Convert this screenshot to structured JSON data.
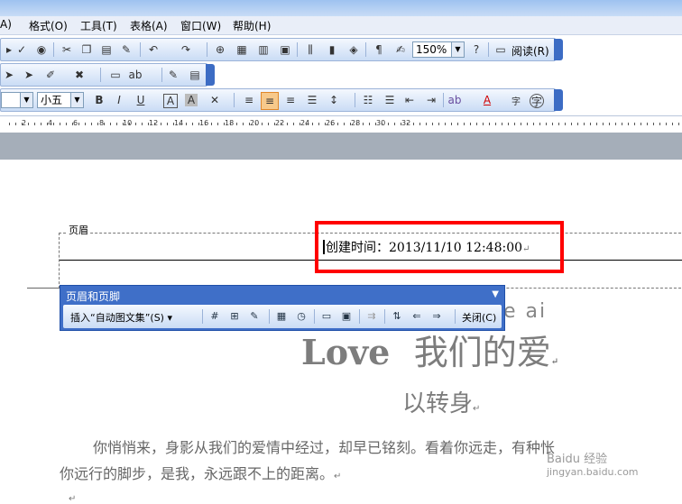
{
  "menubar": {
    "items": [
      "A)",
      "格式(O)",
      "工具(T)",
      "表格(A)",
      "窗口(W)",
      "帮助(H)"
    ]
  },
  "toolbar": {
    "zoom": "150%",
    "read_label": "阅读(R)",
    "font_size": "小五"
  },
  "ruler": {
    "numbers": [
      "2",
      "4",
      "6",
      "8",
      "10",
      "12",
      "14",
      "16",
      "18",
      "20",
      "22",
      "24",
      "26",
      "28",
      "30",
      "32"
    ]
  },
  "header": {
    "label": "页眉",
    "text": "创建时间：2013/11/10 12:48:00"
  },
  "hf_toolbar": {
    "title": "页眉和页脚",
    "insert_autotext": "插入“自动图文集”(S)",
    "close_label": "关闭(C)"
  },
  "document": {
    "line_ai": "e ai",
    "love_en": "Love",
    "love_cn": "我们的爱",
    "turn": "以转身",
    "para1": "你悄悄来，身影从我们的爱情中经过，却早已铭刻。看着你远走，有种怅",
    "para2": "你远行的脚步，是我，永远跟不上的距离。"
  },
  "watermark": {
    "cn": "Baidu 经验",
    "en": "jingyan.baidu.com"
  },
  "colors": {
    "highlight": "#ff0000",
    "toolbar_blue": "#3f6fc8"
  }
}
